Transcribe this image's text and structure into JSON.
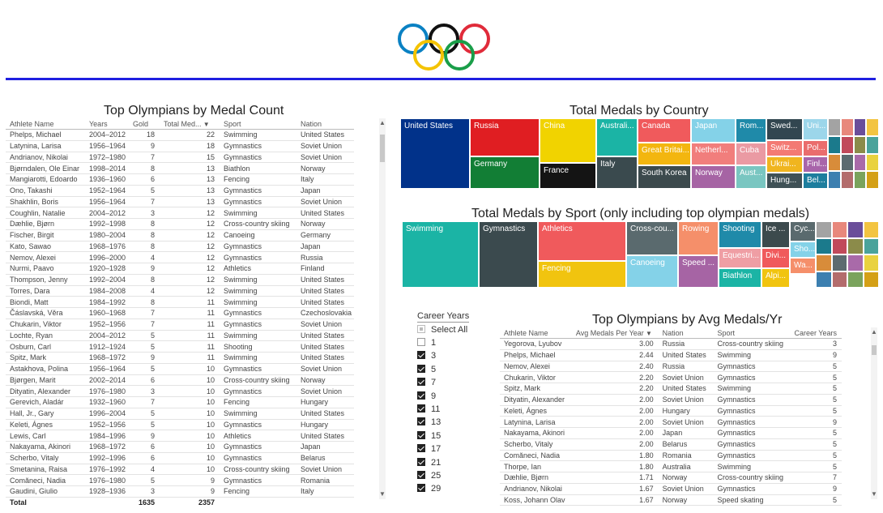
{
  "left_table": {
    "title": "Top Olympians by Medal Count",
    "headers": [
      "Athlete Name",
      "Years",
      "Gold",
      "Total Med...",
      "Sport",
      "Nation"
    ],
    "rows": [
      [
        "Phelps, Michael",
        "2004–2012",
        "18",
        "22",
        "Swimming",
        "United States"
      ],
      [
        "Latynina, Larisa",
        "1956–1964",
        "9",
        "18",
        "Gymnastics",
        "Soviet Union"
      ],
      [
        "Andrianov, Nikolai",
        "1972–1980",
        "7",
        "15",
        "Gymnastics",
        "Soviet Union"
      ],
      [
        "Bjørndalen, Ole Einar",
        "1998–2014",
        "8",
        "13",
        "Biathlon",
        "Norway"
      ],
      [
        "Mangiarotti, Edoardo",
        "1936–1960",
        "6",
        "13",
        "Fencing",
        "Italy"
      ],
      [
        "Ono, Takashi",
        "1952–1964",
        "5",
        "13",
        "Gymnastics",
        "Japan"
      ],
      [
        "Shakhlin, Boris",
        "1956–1964",
        "7",
        "13",
        "Gymnastics",
        "Soviet Union"
      ],
      [
        "Coughlin, Natalie",
        "2004–2012",
        "3",
        "12",
        "Swimming",
        "United States"
      ],
      [
        "Dæhlie, Bjørn",
        "1992–1998",
        "8",
        "12",
        "Cross-country skiing",
        "Norway"
      ],
      [
        "Fischer, Birgit",
        "1980–2004",
        "8",
        "12",
        "Canoeing",
        "Germany"
      ],
      [
        "Kato, Sawao",
        "1968–1976",
        "8",
        "12",
        "Gymnastics",
        "Japan"
      ],
      [
        "Nemov, Alexei",
        "1996–2000",
        "4",
        "12",
        "Gymnastics",
        "Russia"
      ],
      [
        "Nurmi, Paavo",
        "1920–1928",
        "9",
        "12",
        "Athletics",
        "Finland"
      ],
      [
        "Thompson, Jenny",
        "1992–2004",
        "8",
        "12",
        "Swimming",
        "United States"
      ],
      [
        "Torres, Dara",
        "1984–2008",
        "4",
        "12",
        "Swimming",
        "United States"
      ],
      [
        "Biondi, Matt",
        "1984–1992",
        "8",
        "11",
        "Swimming",
        "United States"
      ],
      [
        "Čáslavská, Věra",
        "1960–1968",
        "7",
        "11",
        "Gymnastics",
        "Czechoslovakia"
      ],
      [
        "Chukarin, Viktor",
        "1952–1956",
        "7",
        "11",
        "Gymnastics",
        "Soviet Union"
      ],
      [
        "Lochte, Ryan",
        "2004–2012",
        "5",
        "11",
        "Swimming",
        "United States"
      ],
      [
        "Osburn, Carl",
        "1912–1924",
        "5",
        "11",
        "Shooting",
        "United States"
      ],
      [
        "Spitz, Mark",
        "1968–1972",
        "9",
        "11",
        "Swimming",
        "United States"
      ],
      [
        "Astakhova, Polina",
        "1956–1964",
        "5",
        "10",
        "Gymnastics",
        "Soviet Union"
      ],
      [
        "Bjørgen, Marit",
        "2002–2014",
        "6",
        "10",
        "Cross-country skiing",
        "Norway"
      ],
      [
        "Dityatin, Alexander",
        "1976–1980",
        "3",
        "10",
        "Gymnastics",
        "Soviet Union"
      ],
      [
        "Gerevich, Aladár",
        "1932–1960",
        "7",
        "10",
        "Fencing",
        "Hungary"
      ],
      [
        "Hall, Jr., Gary",
        "1996–2004",
        "5",
        "10",
        "Swimming",
        "United States"
      ],
      [
        "Keleti, Ágnes",
        "1952–1956",
        "5",
        "10",
        "Gymnastics",
        "Hungary"
      ],
      [
        "Lewis, Carl",
        "1984–1996",
        "9",
        "10",
        "Athletics",
        "United States"
      ],
      [
        "Nakayama, Akinori",
        "1968–1972",
        "6",
        "10",
        "Gymnastics",
        "Japan"
      ],
      [
        "Scherbo, Vitaly",
        "1992–1996",
        "6",
        "10",
        "Gymnastics",
        "Belarus"
      ],
      [
        "Smetanina, Raisa",
        "1976–1992",
        "4",
        "10",
        "Cross-country skiing",
        "Soviet Union"
      ],
      [
        "Comăneci, Nadia",
        "1976–1980",
        "5",
        "9",
        "Gymnastics",
        "Romania"
      ],
      [
        "Gaudini, Giulio",
        "1928–1936",
        "3",
        "9",
        "Fencing",
        "Italy"
      ]
    ],
    "total": [
      "Total",
      "",
      "1635",
      "2357",
      "",
      ""
    ]
  },
  "country_treemap": {
    "title": "Total Medals by Country",
    "tiles": [
      {
        "label": "United States",
        "color": "#01328a"
      },
      {
        "label": "Russia",
        "color": "#e01e22"
      },
      {
        "label": "Germany",
        "color": "#127e35"
      },
      {
        "label": "China",
        "color": "#f1d300"
      },
      {
        "label": "France",
        "color": "#141414"
      },
      {
        "label": "Australi...",
        "color": "#1bb4a5"
      },
      {
        "label": "Italy",
        "color": "#3a4a4e"
      },
      {
        "label": "Canada",
        "color": "#f05a5c"
      },
      {
        "label": "Great Britai...",
        "color": "#f3b60f"
      },
      {
        "label": "South Korea",
        "color": "#3c4a4d"
      },
      {
        "label": "Japan",
        "color": "#84d2e8"
      },
      {
        "label": "Netherl...",
        "color": "#f17e7c"
      },
      {
        "label": "Norway",
        "color": "#a664a4"
      },
      {
        "label": "Rom...",
        "color": "#1f8aa9"
      },
      {
        "label": "Cuba",
        "color": "#ea9aa3"
      },
      {
        "label": "Aust...",
        "color": "#79c6c1"
      },
      {
        "label": "Swed...",
        "color": "#324650"
      },
      {
        "label": "Switz...",
        "color": "#f37a74"
      },
      {
        "label": "Ukrai...",
        "color": "#f0b51f"
      },
      {
        "label": "Hung...",
        "color": "#3f5156"
      },
      {
        "label": "Uni...",
        "color": "#9cd6ea"
      },
      {
        "label": "Pol...",
        "color": "#ea6d6d"
      },
      {
        "label": "Finl...",
        "color": "#a865aa"
      },
      {
        "label": "Bel...",
        "color": "#1d7e9e"
      }
    ]
  },
  "sport_treemap": {
    "title": "Total Medals by Sport (only including top olympian medals)",
    "tiles": [
      {
        "label": "Swimming",
        "color": "#1bb4a5"
      },
      {
        "label": "Gymnastics",
        "color": "#3b4a4e"
      },
      {
        "label": "Athletics",
        "color": "#f05a5c"
      },
      {
        "label": "Fencing",
        "color": "#f1c40f"
      },
      {
        "label": "Cross-cou...",
        "color": "#5a6a6e"
      },
      {
        "label": "Canoeing",
        "color": "#84d2e8"
      },
      {
        "label": "Rowing",
        "color": "#f58f6a"
      },
      {
        "label": "Speed ...",
        "color": "#a664a4"
      },
      {
        "label": "Shooting",
        "color": "#1f8aa9"
      },
      {
        "label": "Equestri...",
        "color": "#ef9ea4"
      },
      {
        "label": "Biathlon",
        "color": "#1bb4a5"
      },
      {
        "label": "Ice ...",
        "color": "#3c4a4d"
      },
      {
        "label": "Divi...",
        "color": "#f05a5c"
      },
      {
        "label": "Alpi...",
        "color": "#f1c40f"
      },
      {
        "label": "Cyc...",
        "color": "#5a6a6e"
      },
      {
        "label": "Sho...",
        "color": "#84d2e8"
      },
      {
        "label": "Wa...",
        "color": "#f58f6a"
      }
    ]
  },
  "slicer": {
    "title": "Career Years",
    "select_all": "Select All",
    "items": [
      {
        "label": "1",
        "checked": false
      },
      {
        "label": "3",
        "checked": true
      },
      {
        "label": "5",
        "checked": true
      },
      {
        "label": "7",
        "checked": true
      },
      {
        "label": "9",
        "checked": true
      },
      {
        "label": "11",
        "checked": true
      },
      {
        "label": "13",
        "checked": true
      },
      {
        "label": "15",
        "checked": true
      },
      {
        "label": "17",
        "checked": true
      },
      {
        "label": "21",
        "checked": true
      },
      {
        "label": "25",
        "checked": true
      },
      {
        "label": "29",
        "checked": true
      }
    ]
  },
  "right_table": {
    "title": "Top Olympians by Avg Medals/Yr",
    "headers": [
      "Athlete Name",
      "Avg Medals Per Year",
      "Nation",
      "Sport",
      "Career Years"
    ],
    "rows": [
      [
        "Yegorova, Lyubov",
        "3.00",
        "Russia",
        "Cross-country skiing",
        "3"
      ],
      [
        "Phelps, Michael",
        "2.44",
        "United States",
        "Swimming",
        "9"
      ],
      [
        "Nemov, Alexei",
        "2.40",
        "Russia",
        "Gymnastics",
        "5"
      ],
      [
        "Chukarin, Viktor",
        "2.20",
        "Soviet Union",
        "Gymnastics",
        "5"
      ],
      [
        "Spitz, Mark",
        "2.20",
        "United States",
        "Swimming",
        "5"
      ],
      [
        "Dityatin, Alexander",
        "2.00",
        "Soviet Union",
        "Gymnastics",
        "5"
      ],
      [
        "Keleti, Ágnes",
        "2.00",
        "Hungary",
        "Gymnastics",
        "5"
      ],
      [
        "Latynina, Larisa",
        "2.00",
        "Soviet Union",
        "Gymnastics",
        "9"
      ],
      [
        "Nakayama, Akinori",
        "2.00",
        "Japan",
        "Gymnastics",
        "5"
      ],
      [
        "Scherbo, Vitaly",
        "2.00",
        "Belarus",
        "Gymnastics",
        "5"
      ],
      [
        "Comăneci, Nadia",
        "1.80",
        "Romania",
        "Gymnastics",
        "5"
      ],
      [
        "Thorpe, Ian",
        "1.80",
        "Australia",
        "Swimming",
        "5"
      ],
      [
        "Dæhlie, Bjørn",
        "1.71",
        "Norway",
        "Cross-country skiing",
        "7"
      ],
      [
        "Andrianov, Nikolai",
        "1.67",
        "Soviet Union",
        "Gymnastics",
        "9"
      ],
      [
        "Koss, Johann Olav",
        "1.67",
        "Norway",
        "Speed skating",
        "5"
      ]
    ]
  }
}
